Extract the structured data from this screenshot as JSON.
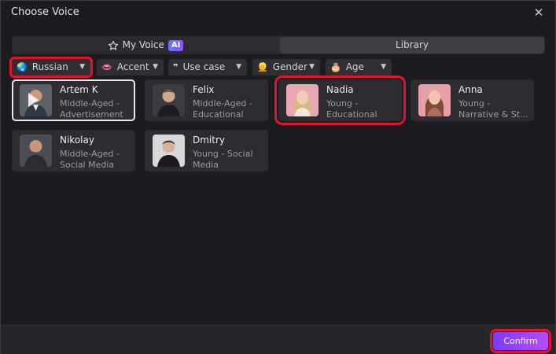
{
  "dialog": {
    "title": "Choose Voice"
  },
  "tabs": {
    "my_voice": "My Voice",
    "ai_badge": "AI",
    "library": "Library"
  },
  "filters": {
    "language": "Russian",
    "accent": "Accent",
    "use_case": "Use case",
    "gender": "Gender",
    "age": "Age"
  },
  "voices": [
    {
      "name": "Artem K",
      "line1": "Middle-Aged -",
      "line2": "Advertisement"
    },
    {
      "name": "Felix",
      "line1": "Middle-Aged -",
      "line2": "Educational"
    },
    {
      "name": "Nadia",
      "line1": "Young -",
      "line2": "Educational"
    },
    {
      "name": "Anna",
      "line1": "Young -",
      "line2": "Narrative & St..."
    },
    {
      "name": "Nikolay",
      "line1": "Middle-Aged -",
      "line2": "Social Media"
    },
    {
      "name": "Dmitry",
      "line1": "Young - Social",
      "line2": "Media"
    }
  ],
  "footer": {
    "confirm_label": "Confirm"
  },
  "colors": {
    "accent_start": "#7a3cff",
    "accent_end": "#b84cff",
    "highlight": "#e0142a"
  }
}
